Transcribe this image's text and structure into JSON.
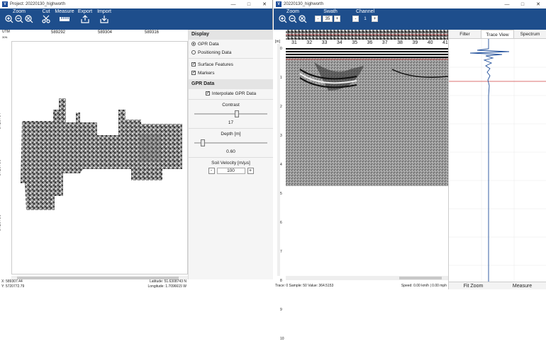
{
  "left_window": {
    "title": "Project: 20220130_highworth",
    "toolbar": {
      "zoom_label": "Zoom",
      "cut_label": "Cut",
      "measure_label": "Measure",
      "export_label": "Export",
      "import_label": "Import"
    },
    "map": {
      "utm_label": "UTM",
      "zone_label": "30N",
      "x_ticks": [
        "589292",
        "589304",
        "589316"
      ],
      "y_ticks": [
        "5720764",
        "5720750",
        "5720736"
      ]
    },
    "side_panel": {
      "display_header": "Display",
      "gpr_data_radio": "GPR Data",
      "positioning_radio": "Positioning Data",
      "surface_features": "Surface Features",
      "markers": "Markers",
      "gpr_header": "GPR Data",
      "interpolate": "Interpolate GPR Data",
      "contrast_label": "Contrast",
      "contrast_value": "17",
      "contrast_level": 0.58,
      "depth_label": "Depth [m]",
      "depth_value": "0.60",
      "depth_level": 0.12,
      "velocity_label": "Soil Velocity [m/μs]",
      "velocity_value": "100",
      "minus": "-",
      "plus": "+"
    },
    "status": {
      "x": "X: 589307.44",
      "y": "Y: 5720772.79",
      "lat": "Latitude: 51.6308743 N",
      "lon": "Longitude: 1.7096615 W"
    }
  },
  "right_window": {
    "title": "20220130_highworth",
    "toolbar": {
      "zoom_label": "Zoom",
      "swath_label": "Swath",
      "channel_label": "Channel",
      "swath_value": "35",
      "channel_value": "1",
      "minus": "-",
      "plus": "+"
    },
    "radar": {
      "x_ticks": [
        "31",
        "32",
        "33",
        "34",
        "35",
        "36",
        "37",
        "38",
        "39",
        "40",
        "41"
      ],
      "y_unit": "[m]",
      "y_ticks": [
        "0",
        "1",
        "2",
        "3",
        "4",
        "5",
        "6",
        "7",
        "8",
        "9",
        "10"
      ]
    },
    "status": {
      "left": "Trace: 0  Sample: 50  Value: 364.5153",
      "right": "Speed: 0.00 km/h | 0.00 mph"
    },
    "trace_panel": {
      "tabs": [
        "Filter",
        "Trace View",
        "Spectrum"
      ],
      "fit_zoom": "Fit Zoom",
      "measure": "Measure"
    }
  },
  "colors": {
    "toolbar_bg": "#1e4e8c",
    "trace_line": "#1f4e9a",
    "marker_line": "#d04040"
  }
}
